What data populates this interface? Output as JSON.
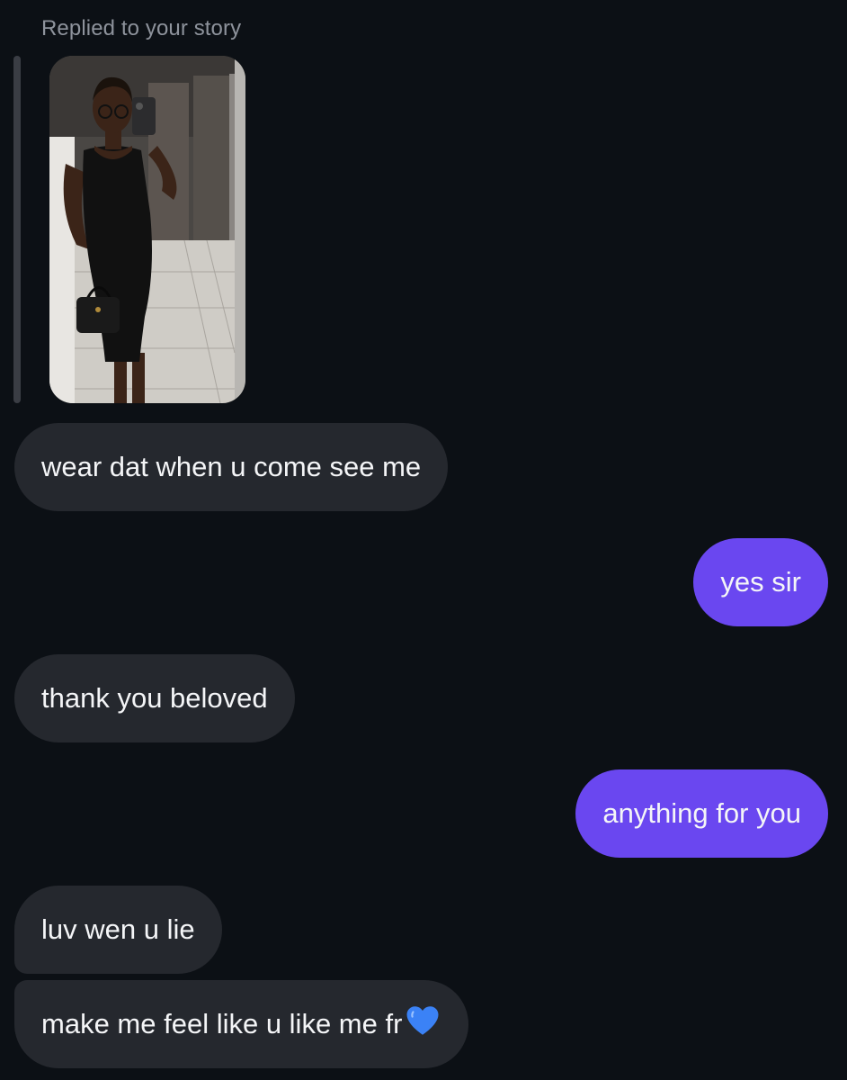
{
  "conversation": {
    "reply_label": "Replied to your story",
    "messages": [
      {
        "side": "received",
        "text": "wear dat when u come see me"
      },
      {
        "side": "sent",
        "text": "yes sir"
      },
      {
        "side": "received",
        "text": "thank you beloved"
      },
      {
        "side": "sent",
        "text": "anything for you"
      },
      {
        "side": "received",
        "text": "luv wen u lie"
      },
      {
        "side": "received",
        "text": "make me feel like u like me fr",
        "emoji": "blue-heart-icon"
      }
    ]
  },
  "colors": {
    "background": "#0c1015",
    "received_bubble": "#25282e",
    "sent_bubble": "#6a47f0",
    "reply_label": "#8e939c",
    "heart": "#3b82f6"
  }
}
